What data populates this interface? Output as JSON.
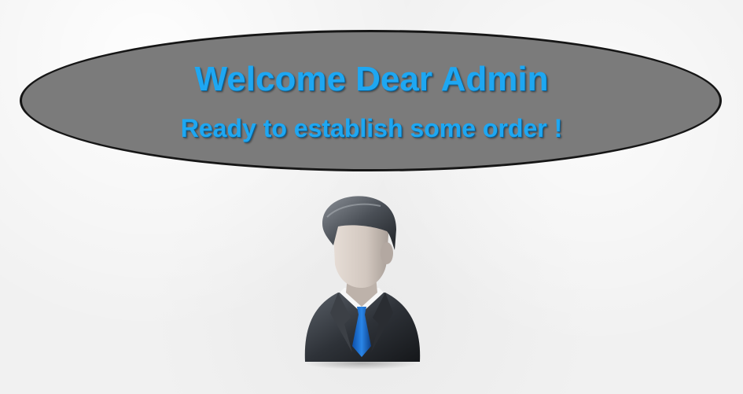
{
  "welcome": {
    "title": "Welcome Dear Admin",
    "subtitle": "Ready to establish some order !"
  },
  "avatar": {
    "icon": "admin-user-icon"
  },
  "colors": {
    "text_accent": "#1ea7f2",
    "bubble_fill": "#7b7b7b",
    "bubble_border": "#161616",
    "background": "#f1f1f1",
    "tie": "#1464c8"
  }
}
